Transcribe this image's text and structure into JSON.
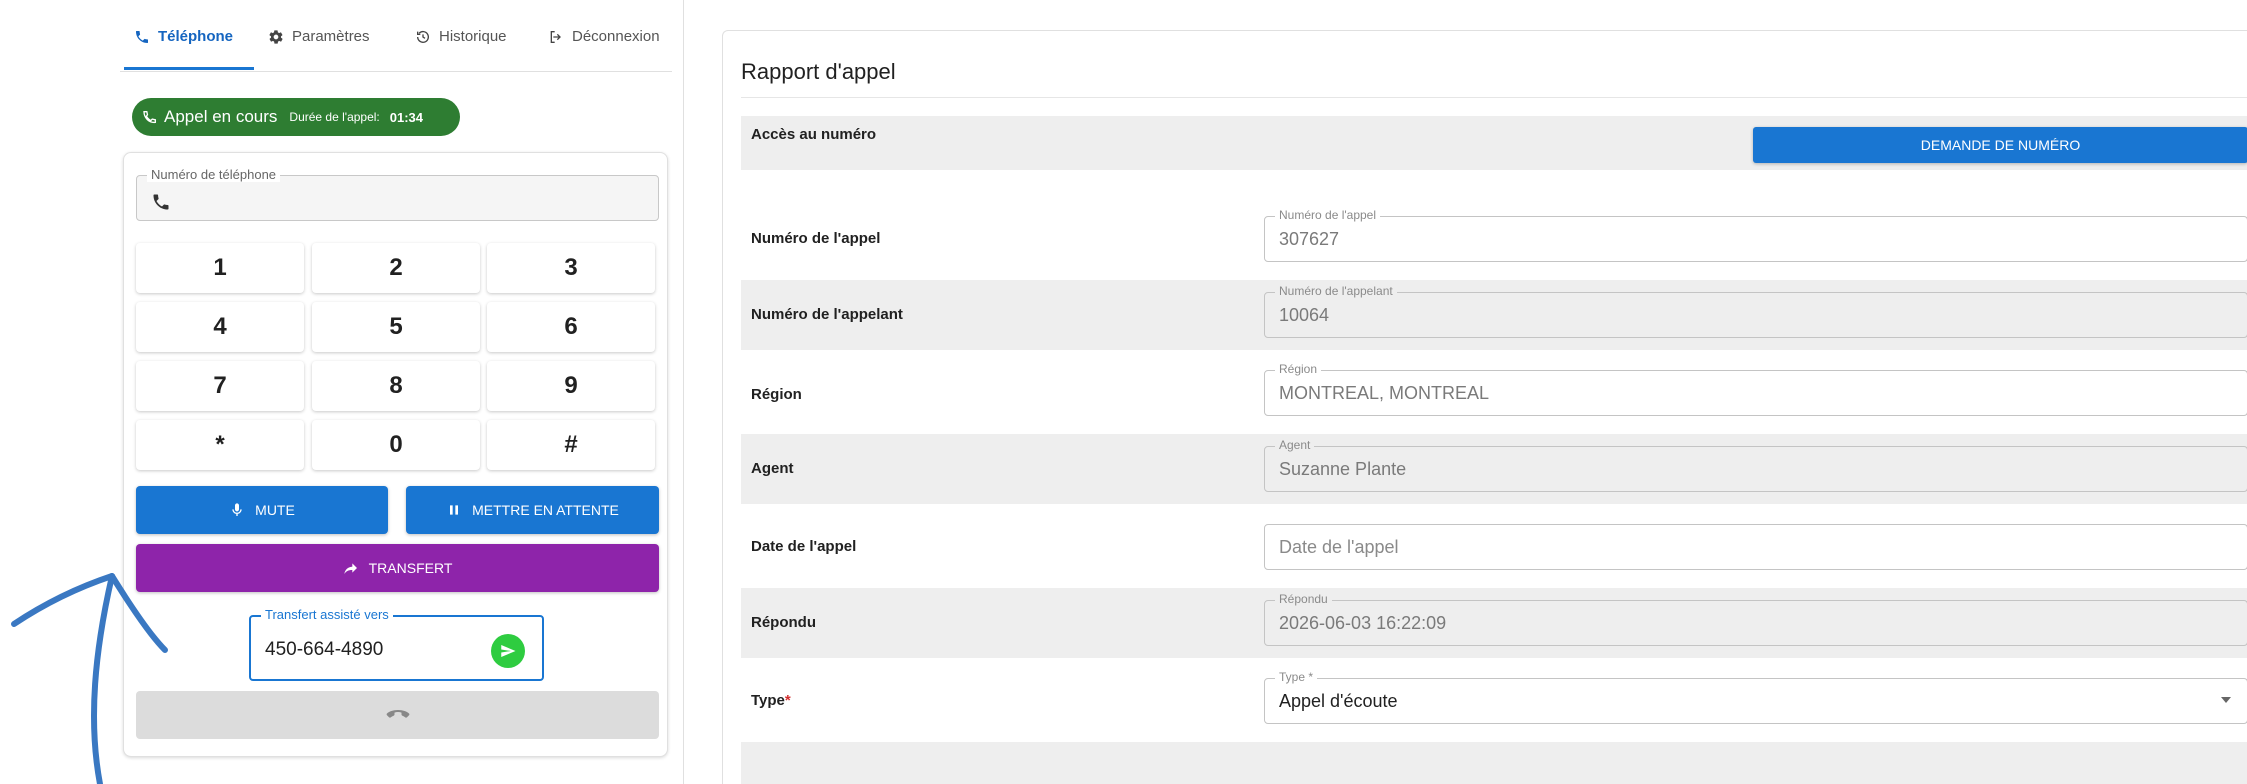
{
  "tabs": [
    {
      "label": "Téléphone",
      "icon": "phone-icon"
    },
    {
      "label": "Paramètres",
      "icon": "gear-icon"
    },
    {
      "label": "Historique",
      "icon": "history-icon"
    },
    {
      "label": "Déconnexion",
      "icon": "logout-icon"
    }
  ],
  "call_status": {
    "status": "Appel en cours",
    "duration_label": "Durée de l'appel:",
    "duration": "01:34"
  },
  "phone_field": {
    "legend": "Numéro de téléphone",
    "value": ""
  },
  "keypad": {
    "keys": [
      "1",
      "2",
      "3",
      "4",
      "5",
      "6",
      "7",
      "8",
      "9",
      "*",
      "0",
      "#"
    ]
  },
  "buttons": {
    "mute": "MUTE",
    "hold": "METTRE EN ATTENTE",
    "transfer": "TRANSFERT"
  },
  "transfer_field": {
    "legend": "Transfert assisté vers",
    "value": "450-664-4890"
  },
  "report": {
    "title": "Rapport d'appel",
    "access_label": "Accès au numéro",
    "request_button": "DEMANDE DE NUMÉRO",
    "rows": [
      {
        "label": "Numéro de l'appel",
        "legend": "Numéro de l'appel",
        "value": "307627"
      },
      {
        "label": "Numéro de l'appelant",
        "legend": "Numéro de l'appelant",
        "value": "10064"
      },
      {
        "label": "Région",
        "legend": "Région",
        "value": "MONTREAL, MONTREAL"
      },
      {
        "label": "Agent",
        "legend": "Agent",
        "value": "Suzanne Plante"
      },
      {
        "label": "Date de l'appel",
        "legend": "",
        "placeholder": "Date de l'appel"
      },
      {
        "label": "Répondu",
        "legend": "Répondu",
        "value": "2026-06-03 16:22:09"
      },
      {
        "label": "Type",
        "required_mark": "*",
        "legend": "Type *",
        "value": "Appel d'écoute"
      }
    ]
  },
  "colors": {
    "primary": "#1976d2",
    "call_green": "#2e7d32",
    "transfer_purple": "#8e24aa",
    "send_green": "#2ecc40",
    "annotation_arrow": "#3a78c2"
  }
}
